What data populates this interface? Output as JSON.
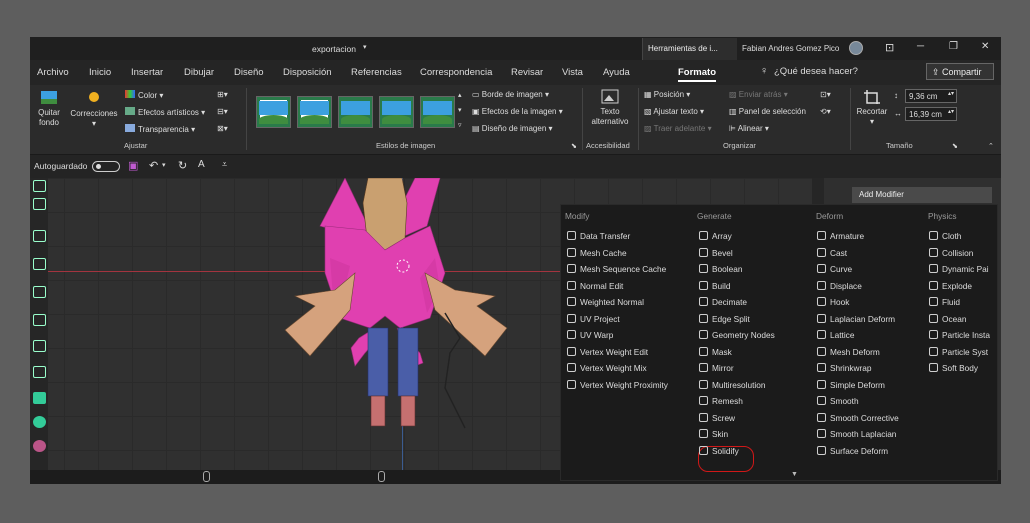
{
  "titlebar": {
    "doc_title": "exportacion",
    "context_tab": "Herramientas de i...",
    "user": "Fabian Andres Gomez Pico",
    "min": "─",
    "restore": "❐",
    "close": "✕"
  },
  "menubar": {
    "tabs": [
      "Archivo",
      "Inicio",
      "Insertar",
      "Dibujar",
      "Diseño",
      "Disposición",
      "Referencias",
      "Correspondencia",
      "Revisar",
      "Vista",
      "Ayuda",
      "Formato"
    ],
    "active": "Formato",
    "tellme": "¿Qué desea hacer?",
    "share": "Compartir"
  },
  "ribbon": {
    "quitar_fondo": [
      "Quitar",
      "fondo"
    ],
    "correcciones": "Correcciones",
    "color": "Color",
    "efectos_artisticos": "Efectos artísticos",
    "transparencia": "Transparencia",
    "group_ajustar": "Ajustar",
    "group_estilos": "Estilos de imagen",
    "borde": "Borde de imagen",
    "efectos": "Efectos de la imagen",
    "diseno": "Diseño de imagen",
    "texto_alt": [
      "Texto",
      "alternativo"
    ],
    "group_accesibilidad": "Accesibilidad",
    "posicion": "Posición",
    "ajustar_texto": "Ajustar texto",
    "traer_adelante": "Traer adelante",
    "enviar_atras": "Enviar atrás",
    "panel_seleccion": "Panel de selección",
    "alinear": "Alinear",
    "group_organizar": "Organizar",
    "recortar": "Recortar",
    "height": "9,36 cm",
    "width": "16,39 cm",
    "group_tamano": "Tamaño"
  },
  "qat": {
    "autosave": "Autoguardado"
  },
  "blender": {
    "add_modifier": "Add Modifier",
    "columns": {
      "modify": {
        "header": "Modify",
        "items": [
          "Data Transfer",
          "Mesh Cache",
          "Mesh Sequence Cache",
          "Normal Edit",
          "Weighted Normal",
          "UV Project",
          "UV Warp",
          "Vertex Weight Edit",
          "Vertex Weight Mix",
          "Vertex Weight Proximity"
        ]
      },
      "generate": {
        "header": "Generate",
        "items": [
          "Array",
          "Bevel",
          "Boolean",
          "Build",
          "Decimate",
          "Edge Split",
          "Geometry Nodes",
          "Mask",
          "Mirror",
          "Multiresolution",
          "Remesh",
          "Screw",
          "Skin",
          "Solidify"
        ]
      },
      "deform": {
        "header": "Deform",
        "items": [
          "Armature",
          "Cast",
          "Curve",
          "Displace",
          "Hook",
          "Laplacian Deform",
          "Lattice",
          "Mesh Deform",
          "Shrinkwrap",
          "Simple Deform",
          "Smooth",
          "Smooth Corrective",
          "Smooth Laplacian",
          "Surface Deform"
        ]
      },
      "physics": {
        "header": "Physics",
        "items": [
          "Cloth",
          "Collision",
          "Dynamic Pai",
          "Explode",
          "Fluid",
          "Ocean",
          "Particle Insta",
          "Particle Syst",
          "Soft Body"
        ]
      }
    },
    "highlighted": "Solidify",
    "more_arrow": "▼"
  },
  "colors": {
    "accent_red": "#d01818",
    "pink": "#e040b0",
    "blue": "#4a5ea8"
  }
}
